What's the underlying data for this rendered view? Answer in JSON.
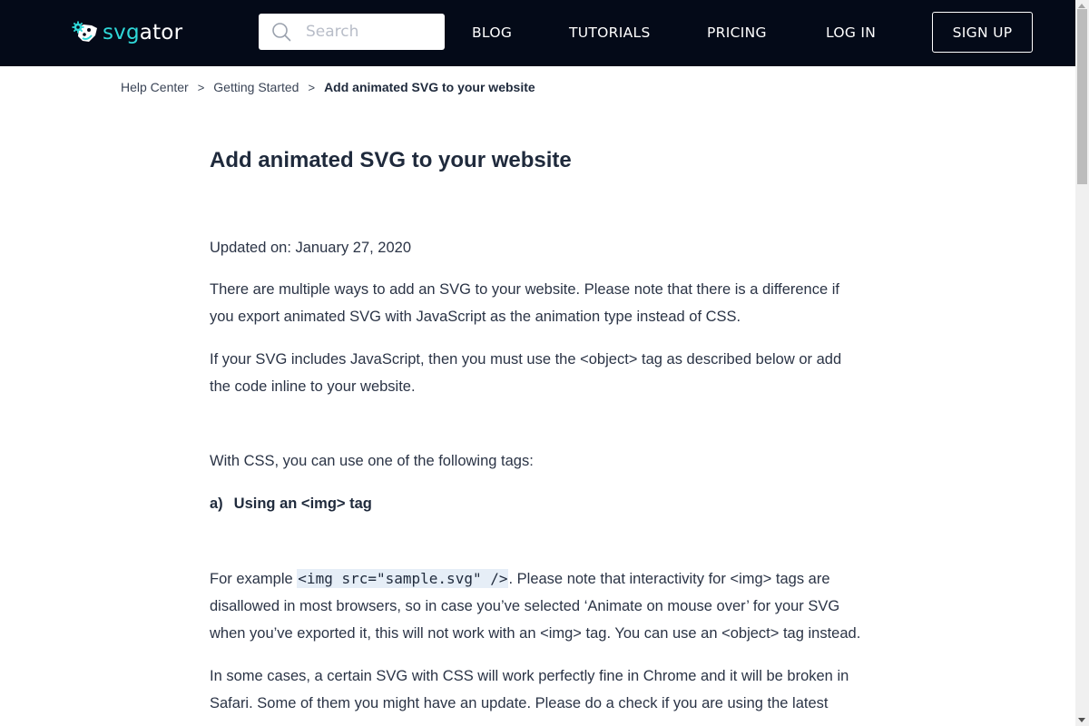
{
  "header": {
    "logo": {
      "part1": "svg",
      "part2": "ator",
      "icon": "svgator-logo-icon",
      "accent_color": "#2fd8d8"
    },
    "search": {
      "placeholder": "Search",
      "value": "",
      "icon": "search-icon"
    },
    "nav": [
      {
        "label": "BLOG"
      },
      {
        "label": "TUTORIALS"
      },
      {
        "label": "PRICING"
      },
      {
        "label": "LOG IN"
      }
    ],
    "signup_label": "SIGN UP",
    "background_color": "#040a18"
  },
  "breadcrumb": {
    "items": [
      {
        "label": "Help Center"
      },
      {
        "label": "Getting Started"
      }
    ],
    "separator": ">",
    "current": "Add animated SVG to your website"
  },
  "article": {
    "title": "Add animated SVG to your website",
    "updated": "Updated on: January 27, 2020",
    "paragraphs": [
      "There are multiple ways to add an SVG to your website. Please note that there is a difference if you export animated SVG with JavaScript as the animation type instead of CSS.",
      "If your SVG includes JavaScript, then you must use the <object> tag as described below or add the code inline to your website.",
      "With CSS, you can use one of the following tags:"
    ],
    "section_a": {
      "letter": "a)",
      "heading": "Using an <img> tag"
    },
    "example": {
      "prefix": "For example ",
      "code": "<img src=\"sample.svg\" />",
      "suffix": ". Please note that interactivity for <img> tags are disallowed in most browsers, so in case you’ve selected ‘Animate on mouse over’ for your SVG when you’ve exported it, this will not work with an <img> tag. You can use an <object> tag instead."
    },
    "last_paragraph": "In some cases, a certain SVG with CSS will work perfectly fine in Chrome and it will be broken in Safari. Some of them you might have an update. Please do a check if you are using the latest"
  }
}
